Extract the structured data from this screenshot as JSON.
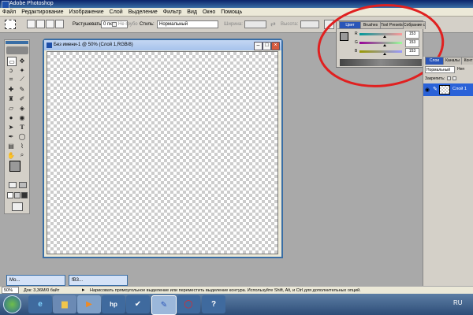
{
  "app": {
    "title": "Adobe Photoshop"
  },
  "menu": [
    "Файл",
    "Редактирование",
    "Изображение",
    "Слой",
    "Выделение",
    "Фильтр",
    "Вид",
    "Окно",
    "Помощь"
  ],
  "options": {
    "feather_label": "Растушевать:",
    "feather_value": "0 пкс",
    "antialias_label": "Не грубо",
    "style_label": "Стиль:",
    "style_value": "Нормальный",
    "width_label": "Ширина:",
    "height_label": "Высота:"
  },
  "document": {
    "title": "Без имени-1 @ 50% (Слой 1,RGB/8)"
  },
  "color_panel": {
    "tabs": [
      "Цвет",
      "Brushes",
      "Tool Presets",
      "Собрание слоев"
    ],
    "channels": [
      {
        "label": "R",
        "value": "153",
        "fraction": 0.6,
        "gradient": "#00999a,#ff9999"
      },
      {
        "label": "G",
        "value": "153",
        "fraction": 0.6,
        "gradient": "#990099,#99ff99"
      },
      {
        "label": "B",
        "value": "153",
        "fraction": 0.6,
        "gradient": "#999900,#9999ff"
      }
    ]
  },
  "layers_panel": {
    "tabs": [
      "Слои",
      "Каналы",
      "Конт"
    ],
    "blend_mode": "Нормальный",
    "opacity_short": "Неп",
    "lock_label": "Закрепить:",
    "layer_name": "Слой 1"
  },
  "minimized_docs": [
    "Мо...",
    "fB3..."
  ],
  "status": {
    "zoom": "50%",
    "doc_info": "Док: 3,36М/0 байт",
    "hint": "Нарисовать прямоугольное выделение или переместить выделение контура. Используйте Shift, Alt, и Ctrl для дополнительных опций."
  },
  "taskbar": {
    "language": "RU"
  },
  "colors": {
    "accent": "#3a6ea5",
    "tab_active": "#2a55b8",
    "layer_selected": "#2a62d8"
  }
}
